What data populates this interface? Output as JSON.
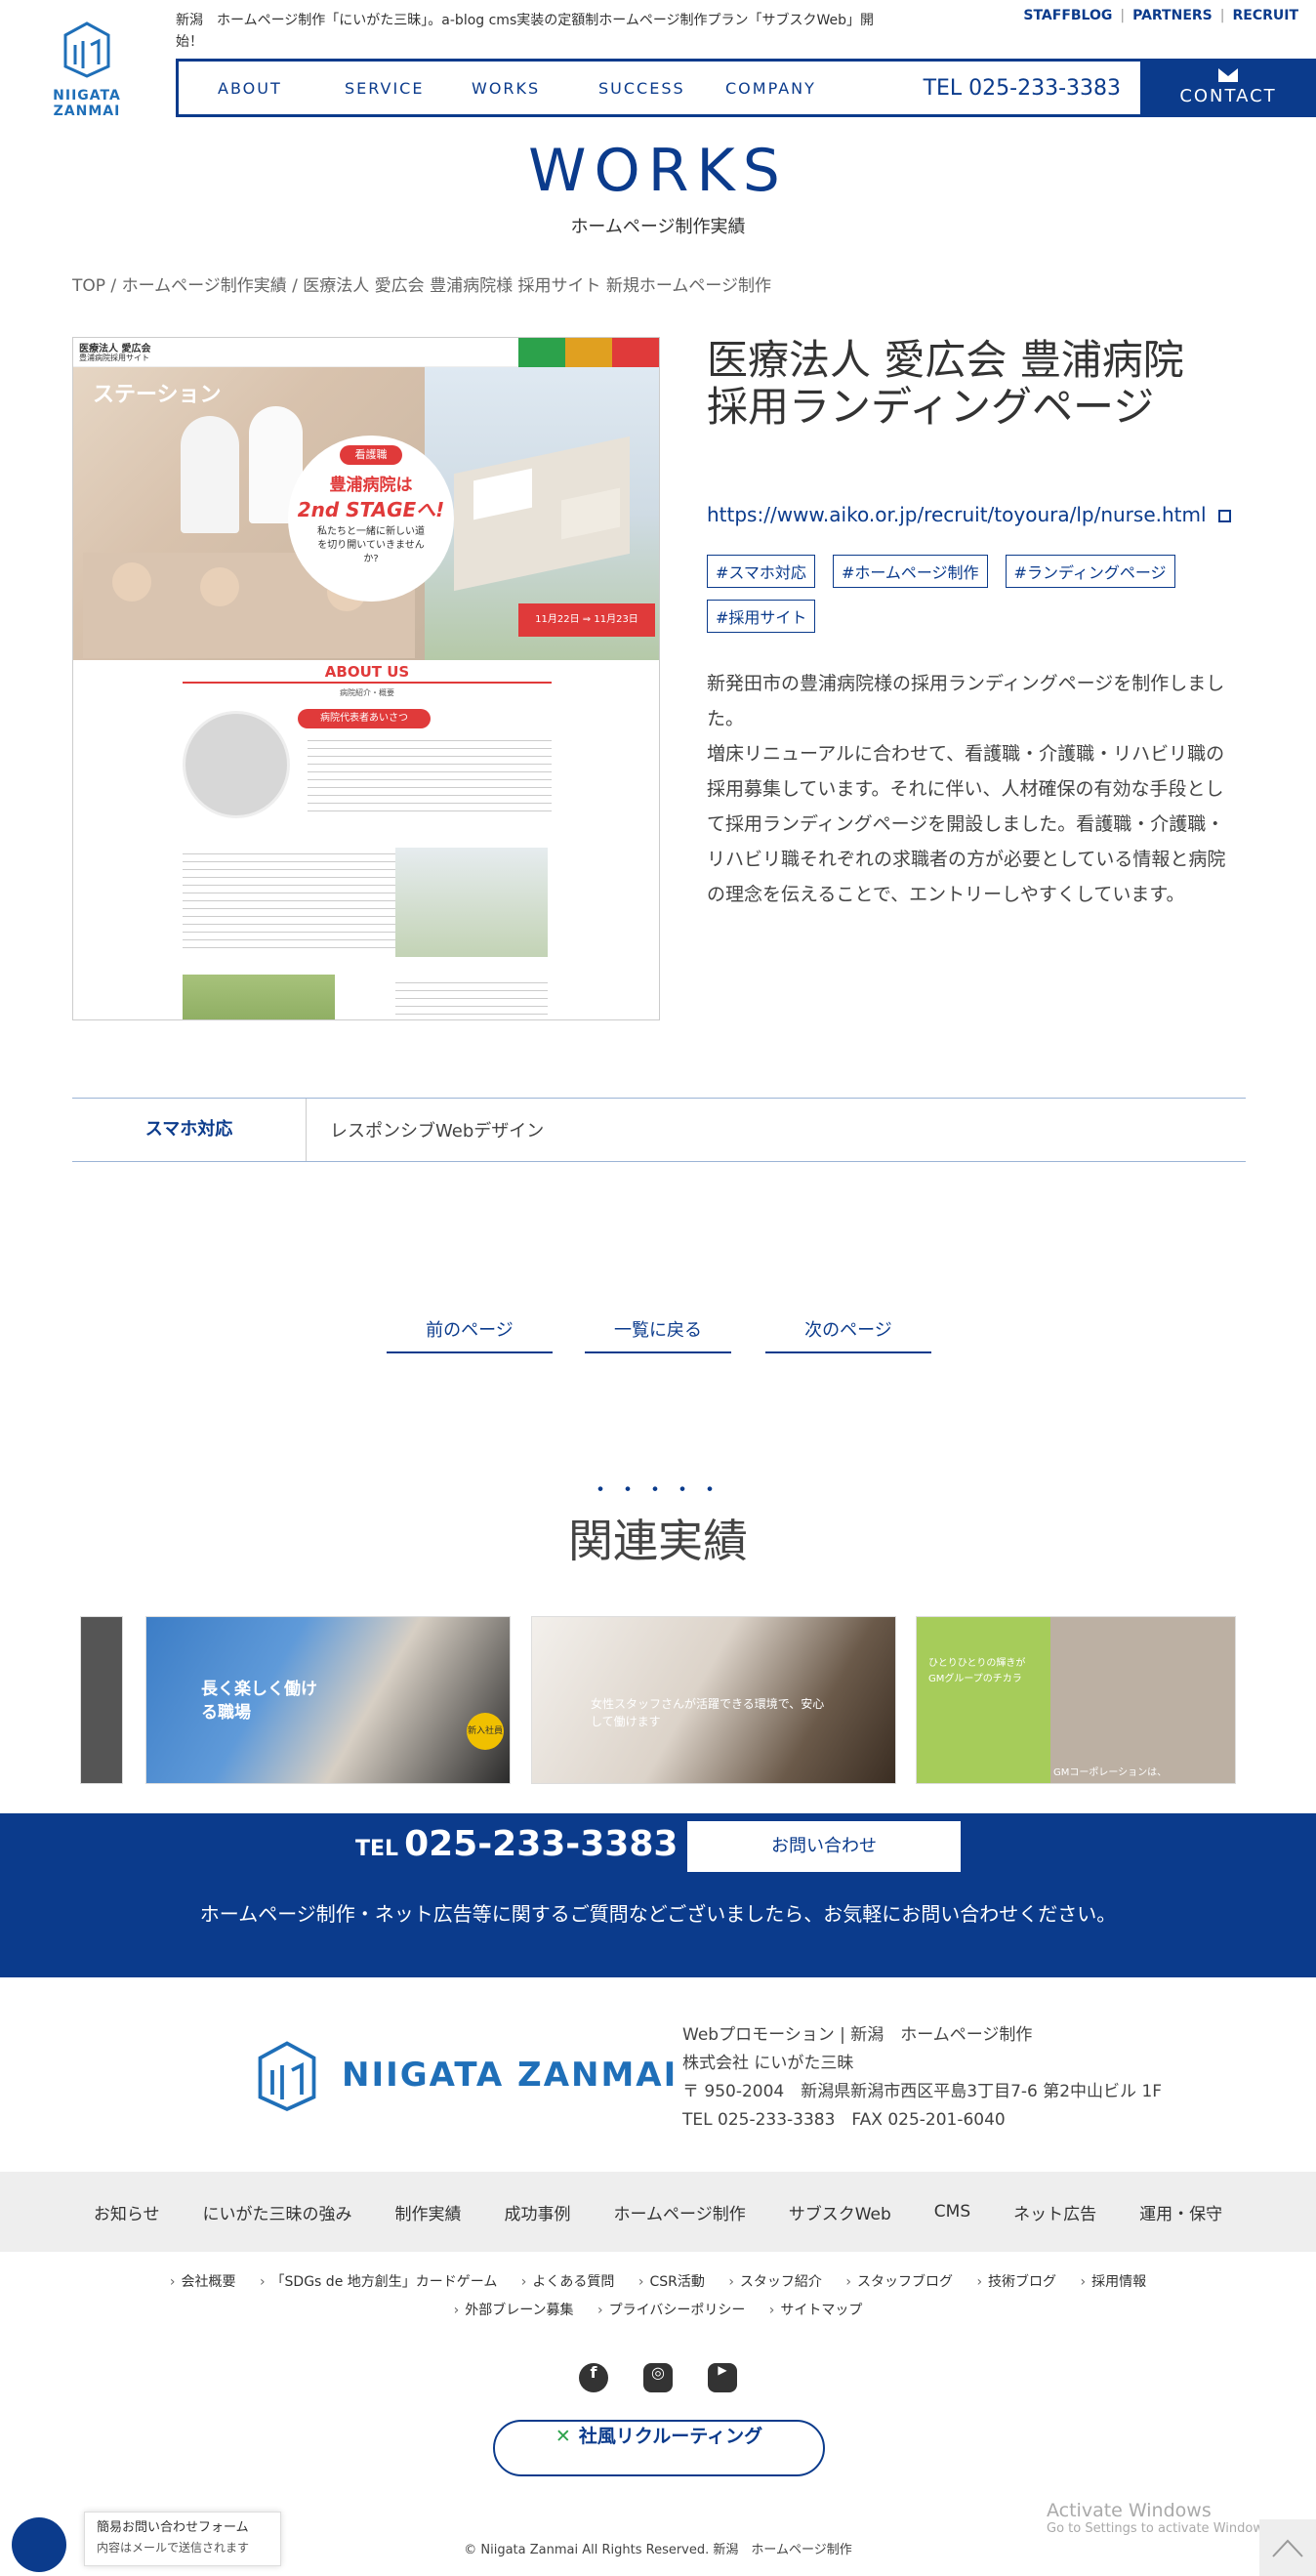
{
  "header": {
    "logo_text": "NIIGATA ZANMAI",
    "announcement": "新潟　ホームページ制作「にいがた三昧」。a-blog cms実装の定額制ホームページ制作プラン「サブスクWeb」開始！",
    "top_links": [
      "STAFFBLOG",
      "PARTNERS",
      "RECRUIT"
    ],
    "nav": [
      "ABOUT",
      "SERVICE",
      "WORKS",
      "SUCCESS",
      "COMPANY"
    ],
    "tel": "TEL 025-233-3383",
    "contact": "CONTACT"
  },
  "page": {
    "title_en": "WORKS",
    "title_ja": "ホームページ制作実績",
    "breadcrumb": [
      "TOP",
      "ホームページ制作実績",
      "医療法人 愛広会 豊浦病院様 採用サイト 新規ホームページ制作"
    ]
  },
  "work": {
    "title_line1": "医療法人 愛広会 豊浦病院",
    "title_line2": "採用ランディングページ",
    "url": "https://www.aiko.or.jp/recruit/toyoura/lp/nurse.html",
    "tags": [
      "#スマホ対応",
      "#ホームページ制作",
      "#ランディングページ",
      "#採用サイト"
    ],
    "description": "新発田市の豊浦病院様の採用ランディングページを制作しました。\n増床リニューアルに合わせて、看護職・介護職・リハビリ職の採用募集しています。それに伴い、人材確保の有効な手段として採用ランディングページを開設しました。看護職・介護職・リハビリ職それぞれの求職者の方が必要としている情報と病院の理念を伝えることで、エントリーしやすくしています。",
    "screenshot": {
      "site_name": "医療法人 愛広会",
      "site_sub": "豊浦病院採用サイト",
      "hero_badge": "看護職",
      "hero_line1": "豊浦病院は",
      "hero_line2": "2nd STAGEへ!",
      "hero_line3": "私たちと一緒に新しい道を切り開いていきませんか?",
      "event": "11月22日 ⇒ 11月23日",
      "about": "ABOUT US",
      "about_sub": "病院紹介・概要",
      "greeting": "病院代表者あいさつ",
      "stage": "ステーション"
    }
  },
  "spec": {
    "key": "スマホ対応",
    "value": "レスポンシブWebデザイン"
  },
  "pager": {
    "prev": "前のページ",
    "list": "一覧に戻る",
    "next": "次のページ"
  },
  "related": {
    "dots": "・・・・・",
    "title": "関連実績",
    "cards": [
      {
        "caption": "長く楽しく働ける職場",
        "badge": "新入社員"
      },
      {
        "caption": "女性スタッフさんが活躍できる環境で、安心して働けます"
      },
      {
        "caption": "ひとりひとりの輝きがGMグループのチカラ",
        "caption2": "GMコーポレーションは、"
      }
    ]
  },
  "cta": {
    "tel_prefix": "TEL",
    "tel": "025-233-3383",
    "button": "お問い合わせ",
    "message": "ホームページ制作・ネット広告等に関するご質問などございましたら、お気軽にお問い合わせください。"
  },
  "footer": {
    "logo_text": "NIIGATA ZANMAI",
    "info": [
      "Webプロモーション | 新潟　ホームページ制作",
      "株式会社 にいがた三昧",
      "〒 950-2004　新潟県新潟市西区平島3丁目7-6 第2中山ビル 1F",
      "TEL 025-233-3383　FAX 025-201-6040"
    ],
    "nav": [
      "お知らせ",
      "にいがた三昧の強み",
      "制作実績",
      "成功事例",
      "ホームページ制作",
      "サブスクWeb",
      "CMS",
      "ネット広告",
      "運用・保守"
    ],
    "sub_row1": [
      "会社概要",
      "「SDGs de 地方創生」カードゲーム",
      "よくある質問",
      "CSR活動",
      "スタッフ紹介",
      "スタッフブログ",
      "技術ブログ",
      "採用情報"
    ],
    "sub_row2": [
      "外部ブレーン募集",
      "プライバシーポリシー",
      "サイトマップ"
    ],
    "recruit": "社風リクルーティング",
    "copyright": "© Niigata Zanmai All Rights Reserved. 新潟　ホームページ制作"
  },
  "chat": {
    "title": "簡易お問い合わせフォーム",
    "sub": "内容はメールで送信されます"
  },
  "watermark": {
    "line1": "Activate Windows",
    "line2": "Go to Settings to activate Windows."
  },
  "colors": {
    "brand": "#0b3b8c",
    "logo": "#1f6fb8",
    "accent_red": "#e03a3a"
  }
}
